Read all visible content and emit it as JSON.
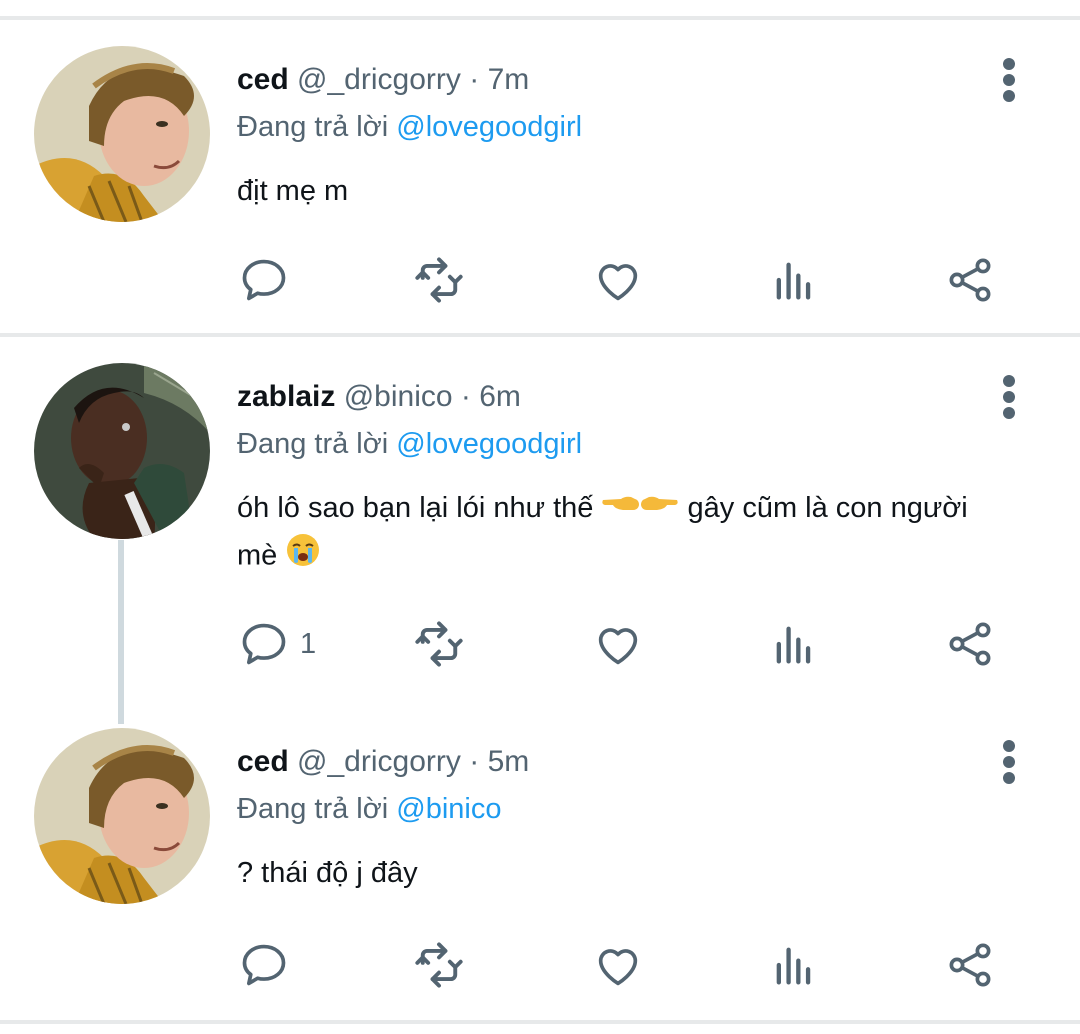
{
  "tweets": [
    {
      "name": "ced",
      "handle": "@_dricgorry",
      "separator": "·",
      "time": "7m",
      "replying_prefix": "Đang trả lời",
      "replying_to": "@lovegoodgirl",
      "text": "địt mẹ m",
      "reply_count": ""
    },
    {
      "name": "zablaiz",
      "handle": "@binico",
      "separator": "·",
      "time": "6m",
      "replying_prefix": "Đang trả lời",
      "replying_to": "@lovegoodgirl",
      "text_part1": "óh lô sao bạn lại lói như thế",
      "text_part2": "gây cũm là con người",
      "text_part3": "mè",
      "reply_count": "1"
    },
    {
      "name": "ced",
      "handle": "@_dricgorry",
      "separator": "·",
      "time": "5m",
      "replying_prefix": "Đang trả lời",
      "replying_to": "@binico",
      "text": "? thái độ j đây",
      "reply_count": ""
    }
  ],
  "icons": {
    "reply": "reply-icon",
    "retweet": "retweet-icon",
    "like": "like-icon",
    "analytics": "analytics-icon",
    "share": "share-icon",
    "more": "more-icon"
  },
  "colors": {
    "icon": "#536471",
    "mention": "#1d9bf0",
    "divider": "#e7e9ea"
  }
}
